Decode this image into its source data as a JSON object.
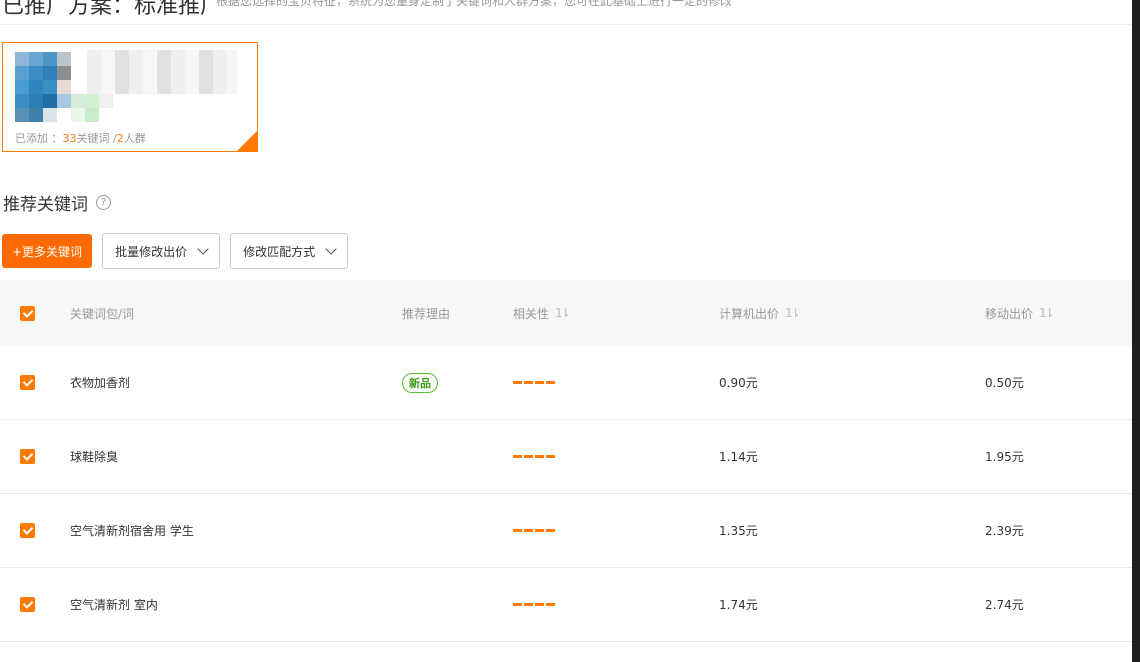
{
  "header": {
    "title": "已推广方案：标准推广",
    "description": "根据您选择的宝贝特征，系统为您量身定制了关键词和人群方案，您可在此基础上进行一定的修改"
  },
  "item_card": {
    "added_prefix": "已添加 ：",
    "keyword_count": "33",
    "keyword_suffix": "关键词 /",
    "crowd_count": "2",
    "crowd_suffix": "人群"
  },
  "section": {
    "title": "推荐关键词"
  },
  "toolbar": {
    "more_keywords": "+更多关键词",
    "batch_bid": "批量修改出价",
    "match_type": "修改匹配方式"
  },
  "table": {
    "headers": {
      "keyword": "关键词包/词",
      "reason": "推荐理由",
      "relevance": "相关性",
      "pc_bid": "计算机出价",
      "mobile_bid": "移动出价",
      "sort_icon": "1⇂"
    },
    "rows": [
      {
        "keyword": "衣物加香剂",
        "reason": "新品",
        "pc_bid": "0.90元",
        "mobile_bid": "0.50元",
        "relevance_level": 4
      },
      {
        "keyword": "球鞋除臭",
        "reason": "",
        "pc_bid": "1.14元",
        "mobile_bid": "1.95元",
        "relevance_level": 4
      },
      {
        "keyword": "空气清新剂宿舍用 学生",
        "reason": "",
        "pc_bid": "1.35元",
        "mobile_bid": "2.39元",
        "relevance_level": 4
      },
      {
        "keyword": "空气清新剂 室内",
        "reason": "",
        "pc_bid": "1.74元",
        "mobile_bid": "2.74元",
        "relevance_level": 4
      }
    ]
  },
  "colors": {
    "accent": "#ff7a00",
    "badge_green": "#5bbf2f"
  }
}
